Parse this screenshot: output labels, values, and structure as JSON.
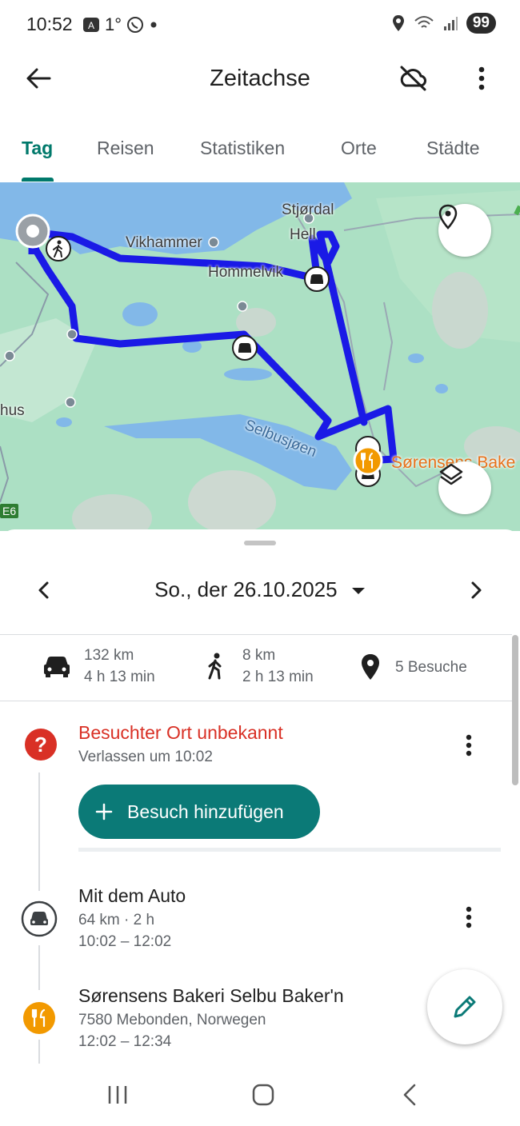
{
  "status": {
    "time": "10:52",
    "temperature": "1°",
    "battery": "99",
    "icons": [
      "translate-icon",
      "whatsapp-icon",
      "dot-icon",
      "location-icon",
      "wifi-icon",
      "signal-icon"
    ]
  },
  "appbar": {
    "title": "Zeitachse",
    "back_icon": "arrow-back-icon",
    "cloud_icon": "cloud-off-icon",
    "more_icon": "more-vert-icon"
  },
  "tabs": [
    {
      "label": "Tag",
      "active": true
    },
    {
      "label": "Reisen",
      "active": false
    },
    {
      "label": "Statistiken",
      "active": false
    },
    {
      "label": "Orte",
      "active": false
    },
    {
      "label": "Städte",
      "active": false
    }
  ],
  "map": {
    "labels": {
      "stjordal": "Stjørdal",
      "hell": "Hell",
      "vikhammer": "Vikhammer",
      "hommelvik": "Hommelvik",
      "selbusjoen": "Selbusjøen",
      "hus": "hus",
      "bakeri": "Sørensens Bake",
      "road": "E6"
    },
    "route_color": "#1a1ae6"
  },
  "date": {
    "label": "So., der 26.10.2025"
  },
  "stats": {
    "drive_distance": "132 km",
    "drive_time": "4 h 13 min",
    "walk_distance": "8 km",
    "walk_time": "2 h 13 min",
    "visits": "5 Besuche"
  },
  "entries": {
    "unknown_title": "Besuchter Ort unbekannt",
    "unknown_sub": "Verlassen um 10:02",
    "add_visit": "Besuch hinzufügen",
    "drive_title": "Mit dem Auto",
    "drive_sub1": "64 km · 2 h",
    "drive_sub2": "10:02 – 12:02",
    "place_title": "Sørensens Bakeri Selbu Baker'n",
    "place_sub1": "7580 Mebonden, Norwegen",
    "place_sub2": "12:02 – 12:34"
  },
  "colors": {
    "accent": "#00796b",
    "unknown": "#d93025",
    "food": "#f29900",
    "button": "#0b7a77"
  }
}
